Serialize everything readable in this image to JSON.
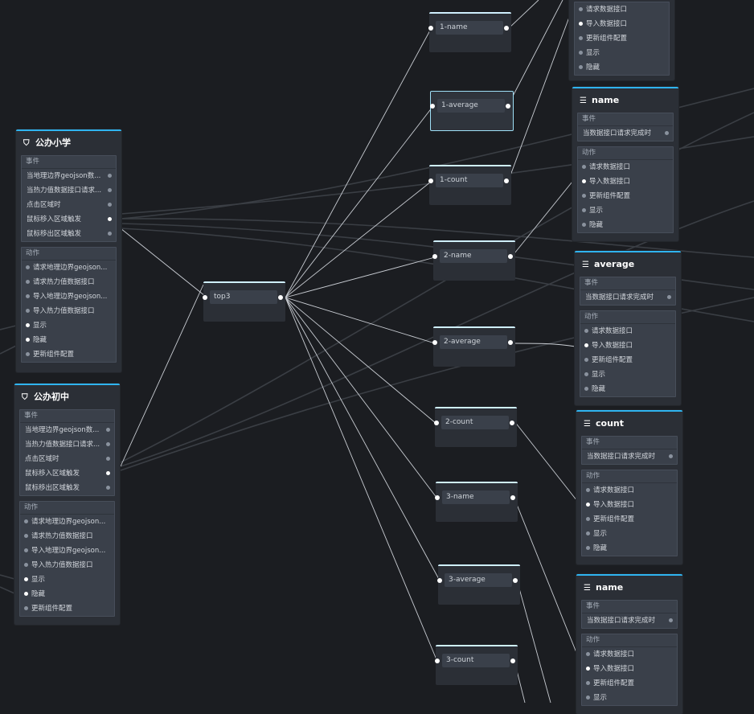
{
  "nodes": {
    "primary_school": {
      "title": "公办小学",
      "icon": "map-pin-icon",
      "events_label": "事件",
      "events": [
        "当地理边界geojson数...",
        "当热力值数据接口请求...",
        "点击区域时",
        "鼠标移入区域触发",
        "鼠标移出区域触发"
      ],
      "actions_label": "动作",
      "actions": [
        "请求地理边界geojson...",
        "请求热力值数据接口",
        "导入地理边界geojson...",
        "导入热力值数据接口",
        "显示",
        "隐藏",
        "更新组件配置"
      ]
    },
    "middle_school": {
      "title": "公办初中",
      "icon": "map-pin-icon",
      "events_label": "事件",
      "events": [
        "当地理边界geojson数...",
        "当热力值数据接口请求...",
        "点击区域时",
        "鼠标移入区域触发",
        "鼠标移出区域触发"
      ],
      "actions_label": "动作",
      "actions": [
        "请求地理边界geojson...",
        "请求热力值数据接口",
        "导入地理边界geojson...",
        "导入热力值数据接口",
        "显示",
        "隐藏",
        "更新组件配置"
      ]
    },
    "top_partial": {
      "actions": [
        "请求数据接口",
        "导入数据接口",
        "更新组件配置",
        "显示",
        "隐藏"
      ]
    },
    "name_1": {
      "title": "name",
      "icon": "text-block-icon",
      "events_label": "事件",
      "events": [
        "当数据接口请求完成时"
      ],
      "actions_label": "动作",
      "actions": [
        "请求数据接口",
        "导入数据接口",
        "更新组件配置",
        "显示",
        "隐藏"
      ]
    },
    "average": {
      "title": "average",
      "icon": "text-block-icon",
      "events_label": "事件",
      "events": [
        "当数据接口请求完成时"
      ],
      "actions_label": "动作",
      "actions": [
        "请求数据接口",
        "导入数据接口",
        "更新组件配置",
        "显示",
        "隐藏"
      ]
    },
    "count": {
      "title": "count",
      "icon": "text-block-icon",
      "events_label": "事件",
      "events": [
        "当数据接口请求完成时"
      ],
      "actions_label": "动作",
      "actions": [
        "请求数据接口",
        "导入数据接口",
        "更新组件配置",
        "显示",
        "隐藏"
      ]
    },
    "name_2": {
      "title": "name",
      "icon": "text-block-icon",
      "events_label": "事件",
      "events": [
        "当数据接口请求完成时"
      ],
      "actions_label": "动作",
      "actions": [
        "请求数据接口",
        "导入数据接口",
        "更新组件配置",
        "显示"
      ]
    }
  },
  "fields": {
    "top3": "top3",
    "n1_name": "1-name",
    "n1_average": "1-average",
    "n1_count": "1-count",
    "n2_name": "2-name",
    "n2_average": "2-average",
    "n2_count": "2-count",
    "n3_name": "3-name",
    "n3_average": "3-average",
    "n3_count": "3-count"
  },
  "colors": {
    "background": "#1b1d21",
    "node_accent": "#2fb4f0",
    "field_accent": "#cfeffd",
    "wire": "#c8ccd2"
  }
}
